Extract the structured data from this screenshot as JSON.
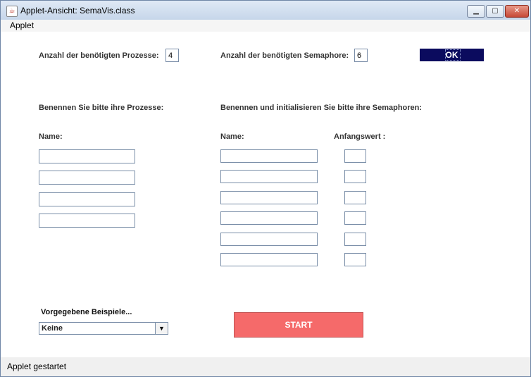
{
  "window": {
    "title": "Applet-Ansicht: SemaVis.class",
    "minimize_glyph": "▁",
    "maximize_glyph": "▢",
    "close_glyph": "✕"
  },
  "menu": {
    "items": [
      "Applet"
    ]
  },
  "config": {
    "processes_label": "Anzahl der benötigten Prozesse:",
    "processes_value": "4",
    "semaphores_label": "Anzahl der benötigten Semaphore:",
    "semaphores_value": "6",
    "ok_label": "OK"
  },
  "processes": {
    "heading": "Benennen Sie bitte ihre Prozesse:",
    "name_header": "Name:",
    "rows": [
      {
        "name": ""
      },
      {
        "name": ""
      },
      {
        "name": ""
      },
      {
        "name": ""
      }
    ]
  },
  "semaphores": {
    "heading": "Benennen und initialisieren Sie bitte ihre Semaphoren:",
    "name_header": "Name:",
    "init_header": "Anfangswert :",
    "rows": [
      {
        "name": "",
        "init": ""
      },
      {
        "name": "",
        "init": ""
      },
      {
        "name": "",
        "init": ""
      },
      {
        "name": "",
        "init": ""
      },
      {
        "name": "",
        "init": ""
      },
      {
        "name": "",
        "init": ""
      }
    ]
  },
  "examples": {
    "label": "Vorgegebene Beispiele...",
    "selected": "Keine"
  },
  "start_label": "START",
  "status": "Applet gestartet",
  "colors": {
    "ok_button": "#0b0b5e",
    "start_button": "#f56a6a"
  }
}
